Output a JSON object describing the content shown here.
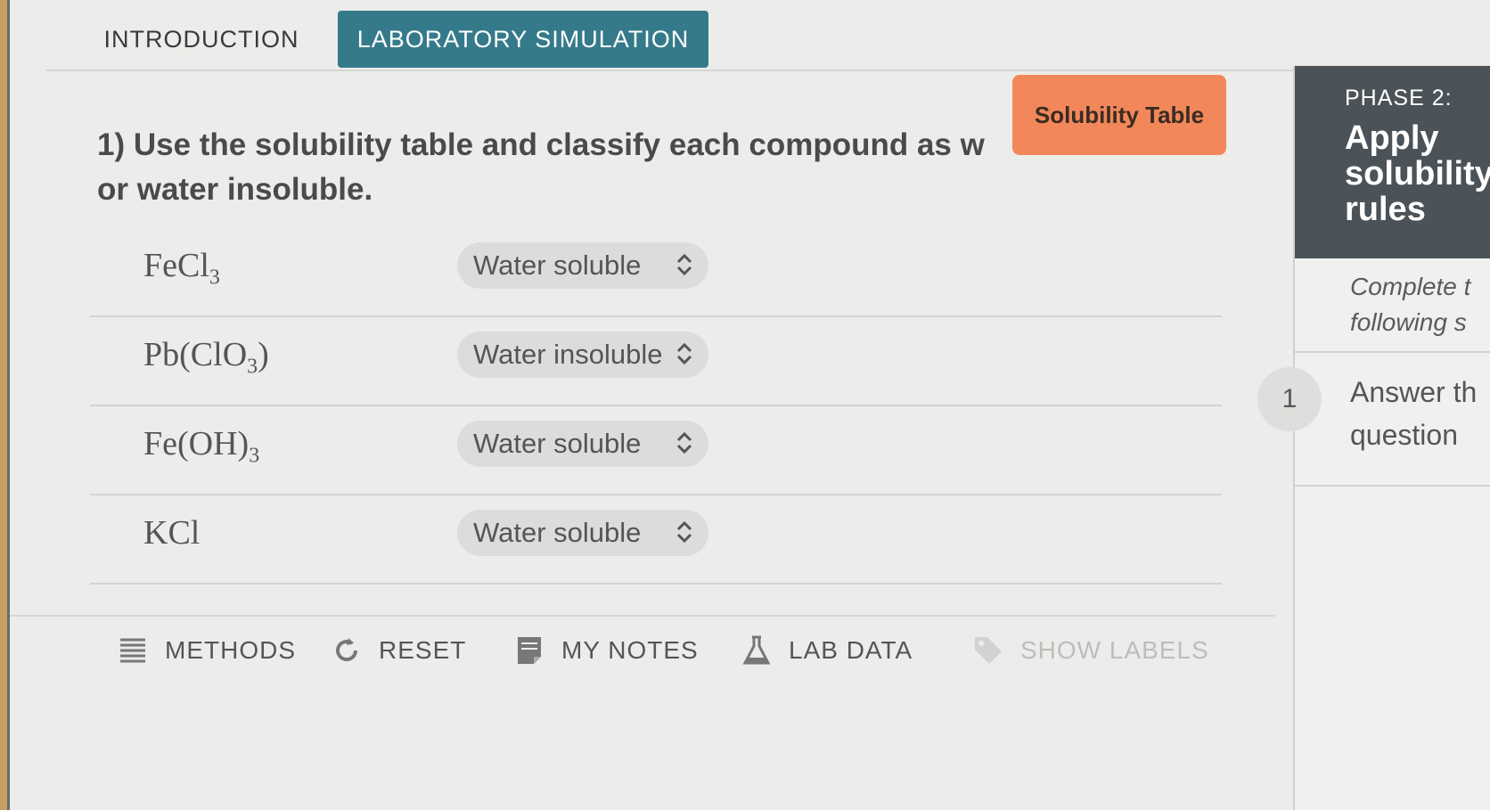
{
  "tabs": {
    "intro": "INTRODUCTION",
    "lab": "LABORATORY SIMULATION"
  },
  "solubility_button": "Solubility Table",
  "question": "1) Use the solubility table and classify each compound as w or water insoluble.",
  "rows": [
    {
      "formula": "FeCl",
      "sub": "3",
      "tail": "",
      "value": "Water soluble"
    },
    {
      "formula": "Pb(ClO",
      "sub": "3",
      "tail": ")",
      "value": "Water insoluble"
    },
    {
      "formula": "Fe(OH)",
      "sub": "3",
      "tail": "",
      "value": "Water soluble"
    },
    {
      "formula": "KCl",
      "sub": "",
      "tail": "",
      "value": "Water soluble"
    }
  ],
  "toolbar": {
    "methods": "METHODS",
    "reset": "RESET",
    "notes": "MY NOTES",
    "labdata": "LAB DATA",
    "labels": "SHOW LABELS"
  },
  "panel": {
    "phase": "PHASE 2:",
    "title": "Apply\nsolubility\nrules",
    "desc": "Complete t\nfollowing s",
    "step": "1",
    "task": "Answer th\nquestion"
  },
  "colors": {
    "tab_active": "#357a8a",
    "sol_button": "#f2885a",
    "panel_head": "#4b5358"
  }
}
